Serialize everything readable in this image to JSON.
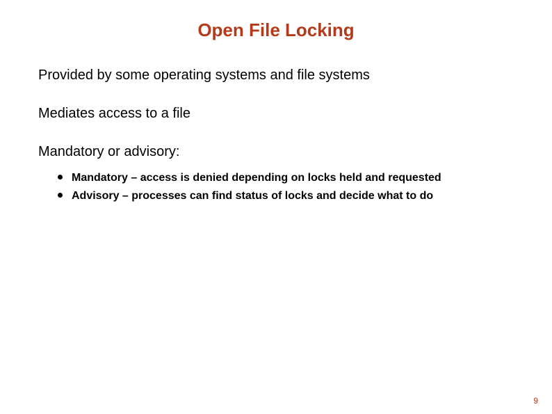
{
  "title": "Open File Locking",
  "points": [
    "Provided by some operating systems and file systems",
    "Mediates access to a file",
    "Mandatory or advisory:"
  ],
  "subitems": [
    "Mandatory – access is denied depending on locks held and requested",
    "Advisory – processes can find status of locks and decide what to do"
  ],
  "page_number": "9"
}
